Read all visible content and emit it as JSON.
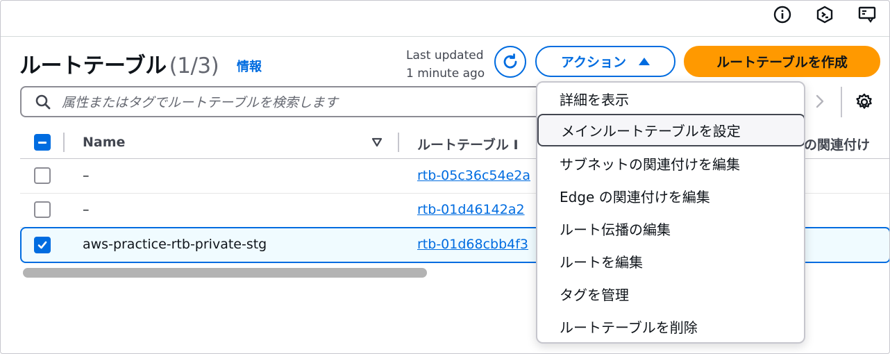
{
  "topbar": {
    "icons": [
      "info-icon",
      "cloudshell-icon",
      "feedback-icon"
    ]
  },
  "header": {
    "title": "ルートテーブル",
    "count": "(1/3)",
    "info_link": "情報",
    "last_updated_line1": "Last updated",
    "last_updated_line2": "1 minute ago",
    "actions_label": "アクション",
    "create_label": "ルートテーブルを作成"
  },
  "search": {
    "placeholder": "属性またはタグでルートテーブルを検索します"
  },
  "table": {
    "columns": [
      "Name",
      "ルートテーブル I",
      "の関連付け"
    ],
    "rows": [
      {
        "name": "–",
        "id": "rtb-05c36c54e2a",
        "checked": false
      },
      {
        "name": "–",
        "id": "rtb-01d46142a2",
        "checked": false
      },
      {
        "name": "aws-practice-rtb-private-stg",
        "id": "rtb-01d68cbb4f3",
        "checked": true
      }
    ]
  },
  "menu": {
    "items": [
      "詳細を表示",
      "メインルートテーブルを設定",
      "サブネットの関連付けを編集",
      "Edge の関連付けを編集",
      "ルート伝播の編集",
      "ルートを編集",
      "タグを管理",
      "ルートテーブルを削除"
    ],
    "highlighted": "メインルートテーブルを設定"
  },
  "colors": {
    "accent": "#006ce0",
    "primary_button": "#ff9900",
    "selected_row_bg": "#f0fbff"
  }
}
